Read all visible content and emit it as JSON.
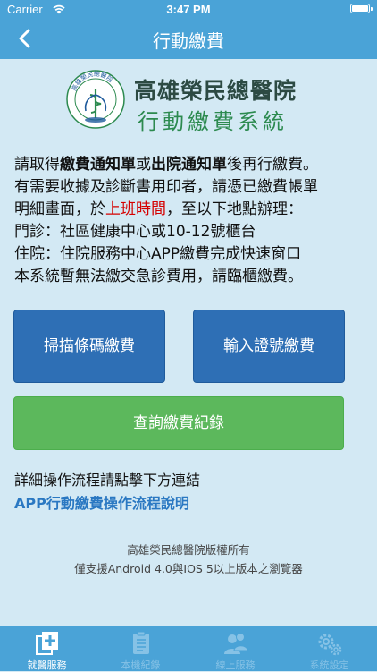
{
  "status_bar": {
    "carrier": "Carrier",
    "time": "3:47 PM"
  },
  "nav": {
    "title": "行動繳費"
  },
  "logo": {
    "line1": "高雄榮民總醫院",
    "line2": "行動繳費系統",
    "seal_text": "高雄榮民總醫院"
  },
  "instructions": {
    "l1_a": "請取得",
    "l1_b": "繳費通知單",
    "l1_c": "或",
    "l1_d": "出院通知單",
    "l1_e": "後再行繳費。",
    "l2": "有需要收據及診斷書用印者，請憑已繳費帳單",
    "l3_a": "明細畫面，於",
    "l3_b": "上班時間",
    "l3_c": "，至以下地點辦理：",
    "l4": "門診：社區健康中心或10-12號櫃台",
    "l5": "住院：住院服務中心APP繳費完成快速窗口",
    "l6": "本系統暫無法繳交急診費用，請臨櫃繳費。"
  },
  "buttons": {
    "scan": "掃描條碼繳費",
    "input": "輸入證號繳費",
    "history": "查詢繳費紀錄"
  },
  "flow": {
    "note": "詳細操作流程請點擊下方連結",
    "link": "APP行動繳費操作流程說明"
  },
  "footer": {
    "copyright": "高雄榮民總醫院版權所有",
    "support": "僅支援Android 4.0與IOS 5以上版本之瀏覽器"
  },
  "tabs": [
    {
      "label": "就醫服務",
      "icon": "medical-card-icon",
      "active": true
    },
    {
      "label": "本機紀錄",
      "icon": "clipboard-icon",
      "active": false
    },
    {
      "label": "線上服務",
      "icon": "people-icon",
      "active": false
    },
    {
      "label": "系統設定",
      "icon": "gears-icon",
      "active": false
    }
  ],
  "colors": {
    "header": "#4aa3d7",
    "background": "#d3e9f4",
    "primary_button": "#2e6fb5",
    "success_button": "#5cb85c",
    "link": "#2a78c2",
    "highlight": "#d50000"
  }
}
